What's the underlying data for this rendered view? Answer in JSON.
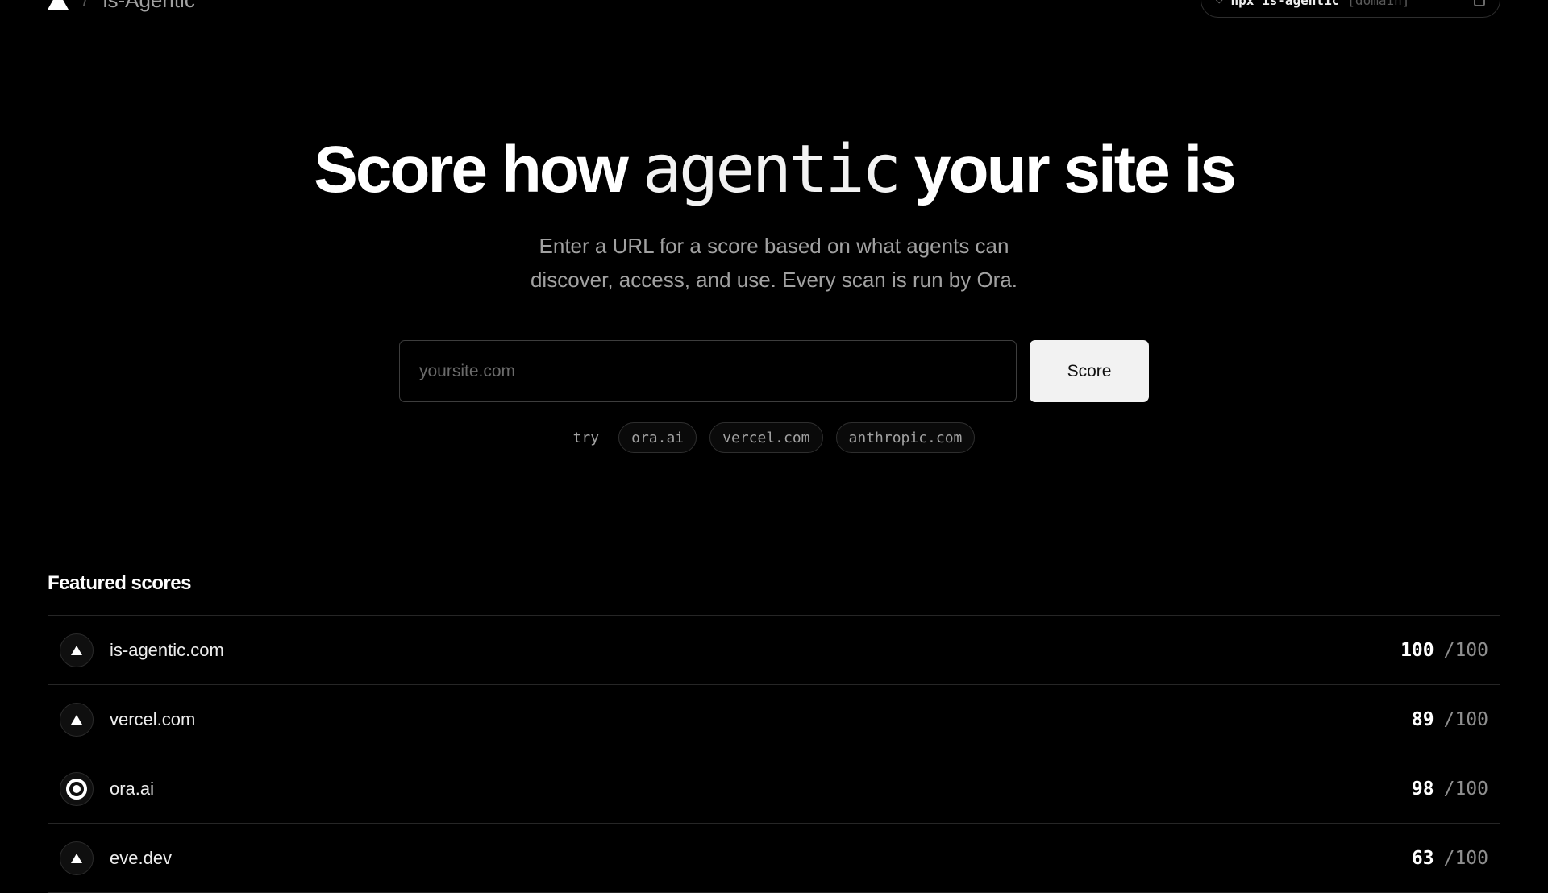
{
  "header": {
    "brand_separator": "/",
    "brand_name": "is-Agentic",
    "cli_prompt": "◇",
    "cli_command": "npx is-agentic",
    "cli_argument": "[domain]"
  },
  "hero": {
    "title_start": "Score how ",
    "title_highlight": "agentic",
    "title_end": " your site is",
    "subtitle": "Enter a URL for a score based on what agents can discover, access, and use. Every scan is run by Ora."
  },
  "search": {
    "placeholder": "yoursite.com",
    "value": "",
    "button_label": "Score"
  },
  "try": {
    "label": "try",
    "suggestions": [
      "ora.ai",
      "vercel.com",
      "anthropic.com"
    ]
  },
  "featured": {
    "title": "Featured scores",
    "rows": [
      {
        "domain": "is-agentic.com",
        "score": "100",
        "max": "/100",
        "icon": "triangle-icon"
      },
      {
        "domain": "vercel.com",
        "score": "89",
        "max": "/100",
        "icon": "triangle-icon"
      },
      {
        "domain": "ora.ai",
        "score": "98",
        "max": "/100",
        "icon": "target-icon"
      },
      {
        "domain": "eve.dev",
        "score": "63",
        "max": "/100",
        "icon": "triangle-icon"
      }
    ]
  }
}
